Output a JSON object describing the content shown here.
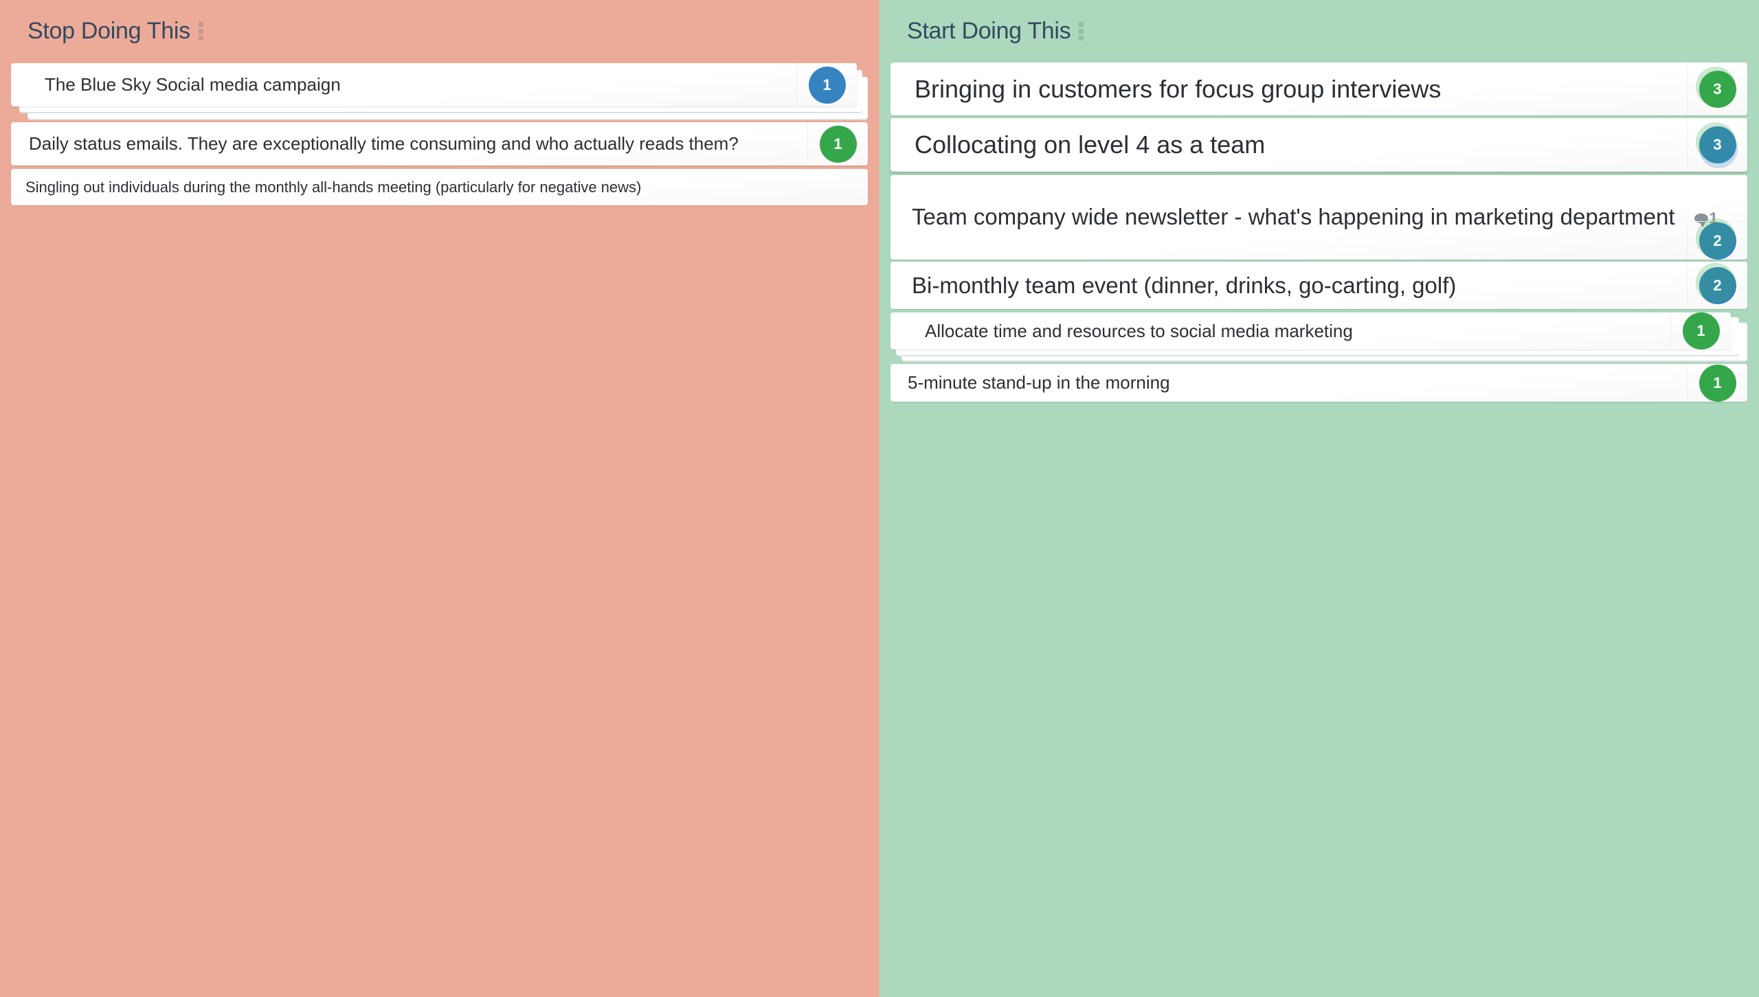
{
  "columns": {
    "stop": {
      "title": "Stop Doing This",
      "color": "#ecab99",
      "cards": [
        {
          "text": "The Blue Sky Social media campaign",
          "votes": "1",
          "badge_color": "blue",
          "stacked": true
        },
        {
          "text": "Daily status emails. They are exceptionally time consuming and who actually reads them?",
          "votes": "1",
          "badge_color": "green"
        },
        {
          "text": "Singling out individuals during the monthly all-hands meeting (particularly for negative news)"
        }
      ]
    },
    "start": {
      "title": "Start Doing This",
      "color": "#acd8be",
      "cards": [
        {
          "text": "Bringing in customers for focus group interviews",
          "votes": "3",
          "badge_color": "green"
        },
        {
          "text": "Collocating on level 4 as a team",
          "votes": "3",
          "badge_color": "blue"
        },
        {
          "text": "Team company wide newsletter - what's happening in marketing department",
          "votes": "2",
          "badge_color": "blue",
          "comments": "1"
        },
        {
          "text": "Bi-monthly team event (dinner, drinks, go-carting, golf)",
          "votes": "2",
          "badge_color": "blue"
        },
        {
          "text": "Allocate time and resources to social media marketing",
          "votes": "1",
          "badge_color": "green",
          "stacked": true
        },
        {
          "text": "5-minute stand-up in the morning",
          "votes": "1",
          "badge_color": "green"
        }
      ]
    }
  },
  "icons": {
    "handle": "drag-handle-icon",
    "comment": "comment-icon"
  }
}
